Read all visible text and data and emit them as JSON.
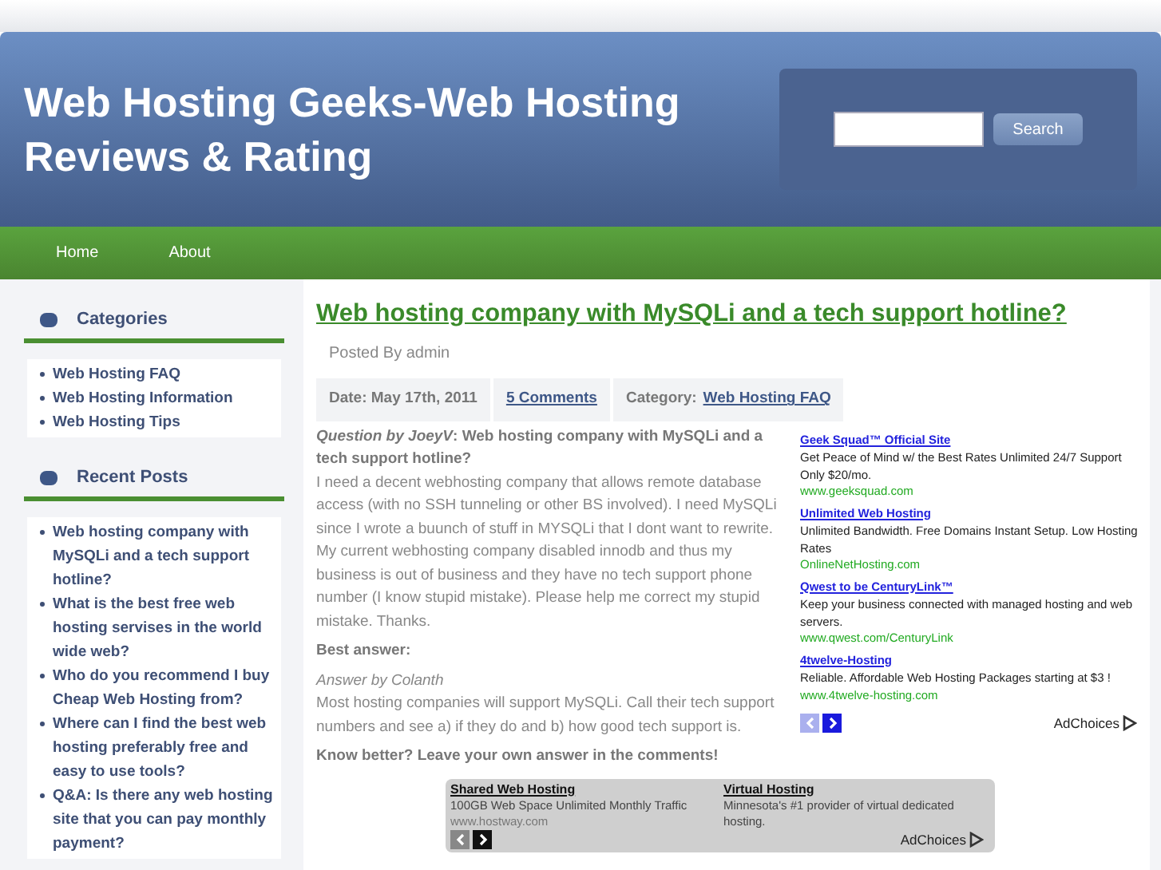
{
  "header": {
    "title": "Web Hosting Geeks-Web Hosting Reviews & Rating",
    "search": {
      "button": "Search"
    }
  },
  "nav": [
    {
      "label": "Home"
    },
    {
      "label": "About"
    }
  ],
  "sidebar": [
    {
      "title": "Categories",
      "items": [
        "Web Hosting FAQ",
        "Web Hosting Information",
        "Web Hosting Tips"
      ]
    },
    {
      "title": "Recent Posts",
      "items": [
        "Web hosting company with MySQLi and a tech support hotline?",
        "What is the best free web hosting servises in the world wide web?",
        "Who do you recommend I buy Cheap Web Hosting from?",
        "Where can I find the best web hosting preferably free and easy to use tools?",
        "Q&A: Is there any web hosting site that you can pay monthly payment?"
      ]
    }
  ],
  "post": {
    "title": "Web hosting company with MySQLi and a tech support hotline?",
    "byline": "Posted By admin",
    "date": "Date: May 17th, 2011",
    "comments": "5 Comments",
    "category_label": "Category:",
    "category": "Web Hosting FAQ",
    "question": "*Question by JoeyV*: Web hosting company with MySQLi and a tech support hotline?",
    "body": "I need a decent webhosting company that allows remote database access (with no SSH tunneling or other BS involved). I need MySQLi since I wrote a buunch of stuff in MYSQLi that I dont want to rewrite. My current webhosting company disabled innodb and thus my business is out of business and they have no tech support phone number (I know stupid mistake). Please help me correct my stupid mistake. Thanks.",
    "best_answer": "Best answer:",
    "answer_by": "Answer by Colanth",
    "answer": "Most hosting companies will support MySQLi. Call their tech support numbers and see a) if they do and b) how good tech support is.",
    "cta": "Know better? Leave your own answer in the comments!"
  },
  "side_ads": {
    "ads": [
      {
        "title": "Geek Squad™ Official Site",
        "text": "Get Peace of Mind w/ the Best Rates Unlimited 24/7 Support Only $20/mo.",
        "url": "www.geeksquad.com"
      },
      {
        "title": "Unlimited Web Hosting",
        "text": "Unlimited Bandwidth. Free Domains Instant Setup. Low Hosting Rates",
        "url": "OnlineNetHosting.com"
      },
      {
        "title": "Qwest to be CenturyLink™",
        "text": "Keep your business connected with managed hosting and web servers.",
        "url": "www.qwest.com/CenturyLink"
      },
      {
        "title": "4twelve-Hosting",
        "text": "Reliable. Affordable Web Hosting Packages starting at $3 !",
        "url": "www.4twelve-hosting.com"
      }
    ],
    "adchoices": "AdChoices"
  },
  "bottom_ads": {
    "ads": [
      {
        "title": "Shared Web Hosting",
        "text": "100GB Web Space Unlimited Monthly Traffic",
        "url": "www.hostway.com"
      },
      {
        "title": "Virtual Hosting",
        "text": "Minnesota's #1 provider of virtual dedicated hosting."
      }
    ],
    "adchoices": "AdChoices"
  }
}
